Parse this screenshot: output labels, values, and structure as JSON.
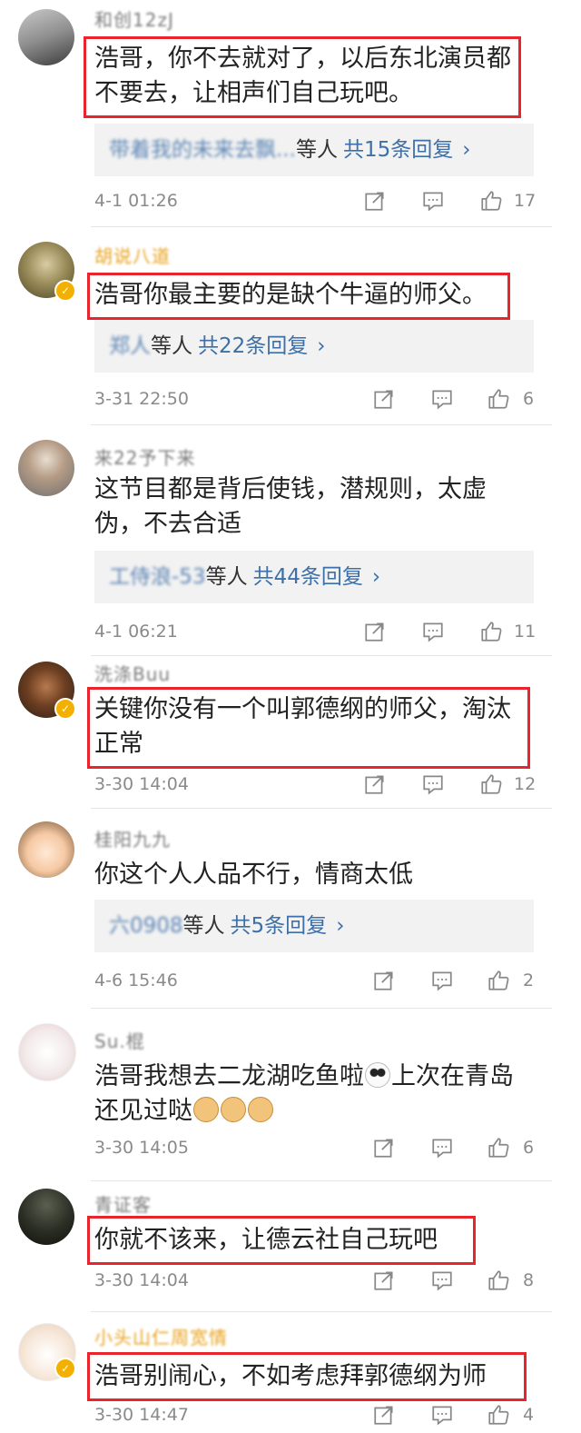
{
  "comments": [
    {
      "username": "和创12zJ",
      "text": "浩哥，你不去就对了，以后东北演员都不要去，让相声们自己玩吧。",
      "reply_preview": "带着我的未来去飘...",
      "reply_who": "等人",
      "reply_count": "共15条回复",
      "time": "4-1 01:26",
      "likes": "17"
    },
    {
      "username": "胡说八道",
      "text": "浩哥你最主要的是缺个牛逼的师父。",
      "reply_preview": "郑人",
      "reply_who": "等人",
      "reply_count": "共22条回复",
      "time": "3-31 22:50",
      "likes": "6"
    },
    {
      "username": "来22予下来",
      "text": "这节目都是背后使钱，潜规则，太虚伪，不去合适",
      "reply_preview": "工侍浪-53",
      "reply_who": "等人",
      "reply_count": "共44条回复",
      "time": "4-1 06:21",
      "likes": "11"
    },
    {
      "username": "洗涤Buu",
      "text": "关键你没有一个叫郭德纲的师父，淘汰正常",
      "time": "3-30 14:04",
      "likes": "12"
    },
    {
      "username": "桂阳九九",
      "text": "你这个人人品不行，情商太低",
      "reply_preview": "六0908",
      "reply_who": "等人",
      "reply_count": "共5条回复",
      "time": "4-6 15:46",
      "likes": "2"
    },
    {
      "username": "Su.棍",
      "text": "浩哥我想去二龙湖吃鱼啦",
      "text2": "上次在青岛还见过哒",
      "time": "3-30 14:05",
      "likes": "6"
    },
    {
      "username": "青证客",
      "text": "你就不该来，让德云社自己玩吧",
      "time": "3-30 14:04",
      "likes": "8"
    },
    {
      "username": "小头山仁周宽情",
      "text": "浩哥别闹心，不如考虑拜郭德纲为师",
      "time": "3-30 14:47",
      "likes": "4"
    }
  ],
  "reply_chevron": "›",
  "colors": {
    "highlight": "#e8252c",
    "link": "#3d6fa8",
    "verified": "#f4b000"
  },
  "icons": [
    "share-icon",
    "comment-icon",
    "like-icon",
    "verified-icon",
    "chevron-right-icon"
  ]
}
